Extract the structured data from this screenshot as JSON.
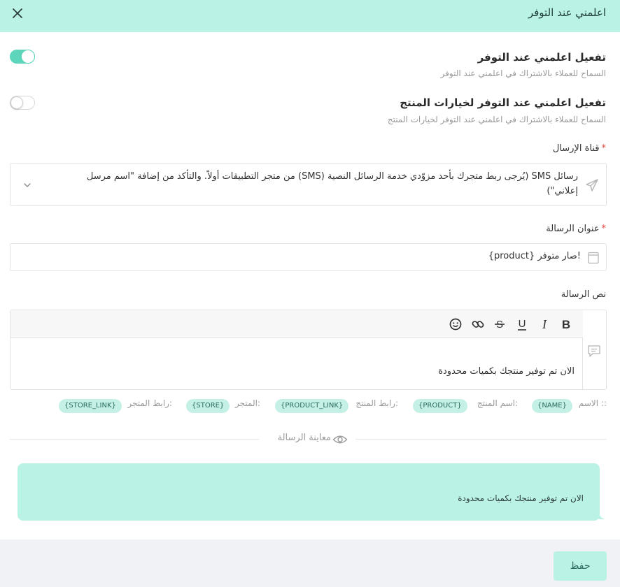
{
  "header": {
    "title": "اعلمني عند التوفر"
  },
  "enable_notify": {
    "title": "تفعيل اعلمني عند التوفر",
    "subtitle": "السماح للعملاء بالاشتراك في اعلمني عند التوفر",
    "enabled": true
  },
  "enable_options": {
    "title": "تفعيل اعلمني عند التوفر لخيارات المنتج",
    "subtitle": "السماح للعملاء بالاشتراك في اعلمني عند التوفر لخيارات المنتج",
    "enabled": false
  },
  "channel": {
    "label": "قناة الإرسال",
    "required_mark": "*",
    "value": "رسائل SMS (يُرجى ربط متجرك بأحد مزوّدي خدمة الرسائل النصية (SMS) من متجر التطبيقات أولاً. والتأكد من إضافة \"اسم مرسل إعلاني\")"
  },
  "subject": {
    "label": "عنوان الرسالة",
    "required_mark": "*",
    "value": "{product} صار متوفر!"
  },
  "body": {
    "label": "نص الرسالة",
    "value": "الان تم توفير منتجك بكميات محدودة"
  },
  "variables": {
    "name_label": "الاسم ::",
    "name_chip": "{NAME}",
    "product_label": "اسم المنتج:",
    "product_chip": "{PRODUCT}",
    "product_link_label": "رابط المنتج:",
    "product_link_chip": "{PRODUCT_LINK}",
    "store_label": "المتجر:",
    "store_chip": "{STORE}",
    "store_link_label": "رابط المتجر:",
    "store_link_chip": "{STORE_LINK}"
  },
  "preview": {
    "label": "معاينة الرسالة",
    "text": "الان تم توفير منتجك بكميات محدودة"
  },
  "footer": {
    "save_label": "حفظ"
  },
  "colors": {
    "accent": "#5dd5bb",
    "header_bg": "#baf3e6",
    "chip_bg": "#c4f0e5",
    "required": "#e5483d"
  }
}
